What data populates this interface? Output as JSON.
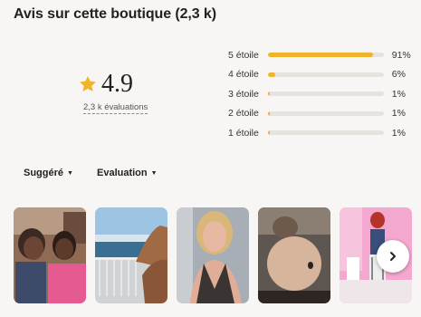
{
  "header": {
    "title": "Avis sur cette boutique (2,3 k)"
  },
  "rating": {
    "score": "4.9",
    "reviews_label": "2,3 k évaluations",
    "star_color": "#f1b329"
  },
  "distribution": [
    {
      "label": "5 étoile",
      "percent_label": "91%",
      "fraction": 0.91
    },
    {
      "label": "4 étoile",
      "percent_label": "6%",
      "fraction": 0.06
    },
    {
      "label": "3 étoile",
      "percent_label": "1%",
      "fraction": 0.01
    },
    {
      "label": "2 étoile",
      "percent_label": "1%",
      "fraction": 0.01
    },
    {
      "label": "1 étoile",
      "percent_label": "1%",
      "fraction": 0.01
    }
  ],
  "filters": {
    "sort_label": "Suggéré",
    "evaluation_label": "Evaluation",
    "caret_icon": "caret-down-icon"
  },
  "photos": {
    "items": [
      {
        "name": "review-photo-1"
      },
      {
        "name": "review-photo-2"
      },
      {
        "name": "review-photo-3"
      },
      {
        "name": "review-photo-4"
      },
      {
        "name": "review-photo-5"
      }
    ],
    "next_icon": "chevron-right-icon"
  }
}
